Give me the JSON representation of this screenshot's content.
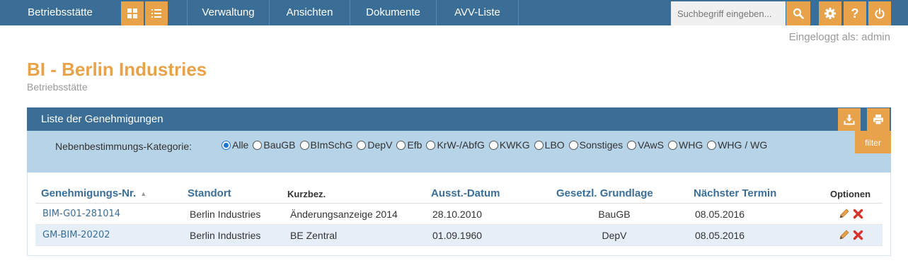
{
  "nav": {
    "brand": "Betriebsstätte",
    "links": [
      "Verwaltung",
      "Ansichten",
      "Dokumente",
      "AVV-Liste"
    ],
    "search_placeholder": "Suchbegriff eingeben...",
    "help_label": "?"
  },
  "user": {
    "logged_in": "Eingeloggt als: admin"
  },
  "page": {
    "title": "BI - Berlin Industries",
    "subtitle": "Betriebsstätte"
  },
  "panel": {
    "title": "Liste der Genehmigungen",
    "filter_label": "Nebenbestimmungs-Kategorie:",
    "filter_button": "filter",
    "categories": [
      "Alle",
      "BauGB",
      "BImSchG",
      "DepV",
      "Efb",
      "KrW-/AbfG",
      "KWKG",
      "LBO",
      "Sonstiges",
      "VAwS",
      "WHG",
      "WHG / WG"
    ],
    "selected_category": "Alle"
  },
  "table": {
    "headers": {
      "nr": "Genehmigungs-Nr.",
      "standort": "Standort",
      "kurzbez": "Kurzbez.",
      "datum": "Ausst.-Datum",
      "grundlage": "Gesetzl. Grundlage",
      "termin": "Nächster Termin",
      "optionen": "Optionen"
    },
    "rows": [
      {
        "nr": "BIM-G01-281014",
        "standort": "Berlin Industries",
        "kurzbez": "Änderungsanzeige 2014",
        "datum": "28.10.2010",
        "grundlage": "BauGB",
        "termin": "08.05.2016"
      },
      {
        "nr": "GM-BIM-20202",
        "standort": "Berlin Industries",
        "kurzbez": "BE Zentral",
        "datum": "01.09.1960",
        "grundlage": "DepV",
        "termin": "08.05.2016"
      }
    ]
  },
  "colors": {
    "primary": "#3b6e97",
    "accent": "#e8a24a",
    "filter_bg": "#b7d3e8",
    "row_alt": "#e6eef7",
    "delete": "#d9342b"
  }
}
